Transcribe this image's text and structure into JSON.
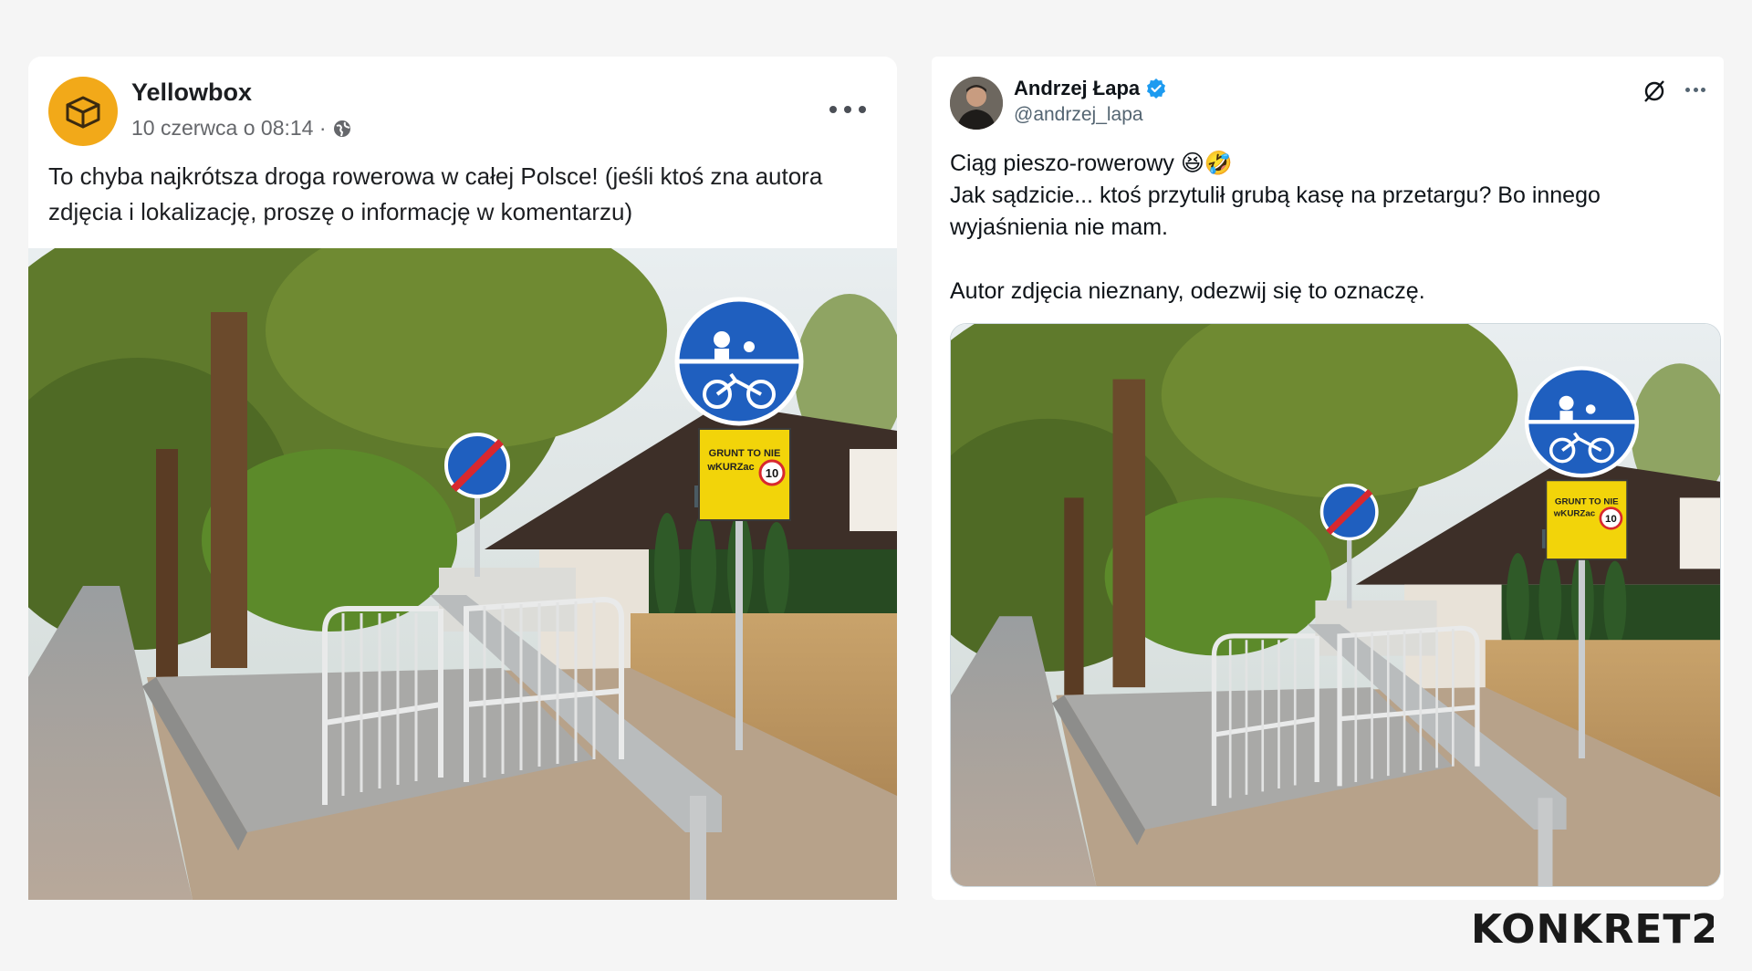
{
  "facebook_post": {
    "author": "Yellowbox",
    "date": "10 czerwca o 08:14 ·",
    "text": "To chyba najkrótsza droga rowerowa w całej Polsce! (jeśli ktoś zna autora zdjęcia i lokalizację, proszę o informację w komentarzu)",
    "avatar_color": "#f2a919",
    "icons": {
      "avatar": "box-icon",
      "privacy": "globe-icon",
      "menu": "more-horizontal-icon"
    }
  },
  "x_post": {
    "author": "Andrzej Łapa",
    "handle": "@andrzej_lapa",
    "verified_color": "#1d9bf0",
    "lines": [
      "Ciąg pieszo-rowerowy 😆🤣",
      "Jak sądzicie... ktoś przytulił grubą kasę na przetargu? Bo innego",
      "wyjaśnienia nie mam.",
      "",
      "Autor zdjęcia nieznany, odezwij się to oznaczę."
    ],
    "icons": {
      "grok": "grok-icon",
      "menu": "more-horizontal-icon",
      "badge": "verified-badge-icon"
    }
  },
  "photo_sign": {
    "plate_line1": "GRUNT TO NIE",
    "plate_line2": "wKURZac",
    "speed": "10"
  },
  "watermark": "KONKRET24"
}
